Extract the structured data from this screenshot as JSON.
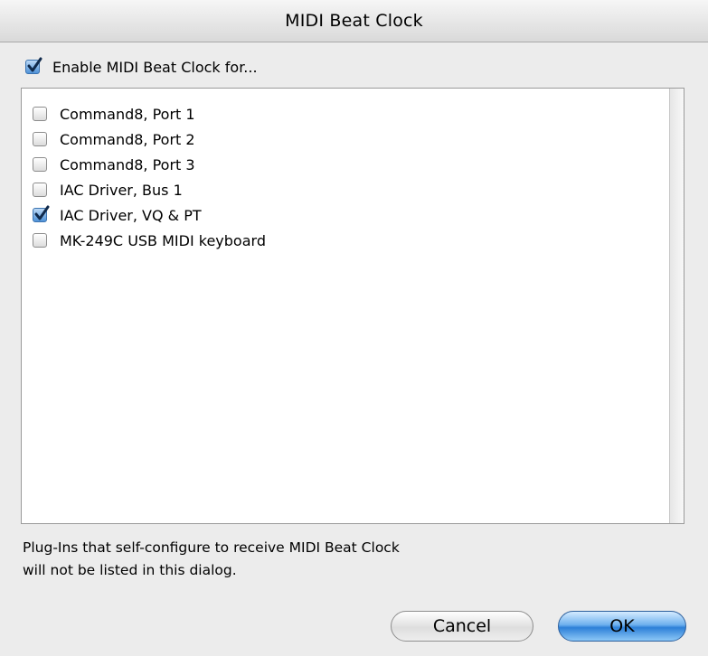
{
  "window": {
    "title": "MIDI Beat Clock"
  },
  "master": {
    "label": "Enable MIDI Beat Clock for...",
    "checked": true
  },
  "ports": [
    {
      "label": "Command8, Port 1",
      "checked": false
    },
    {
      "label": "Command8, Port 2",
      "checked": false
    },
    {
      "label": "Command8, Port 3",
      "checked": false
    },
    {
      "label": "IAC Driver, Bus 1",
      "checked": false
    },
    {
      "label": "IAC Driver, VQ & PT",
      "checked": true
    },
    {
      "label": "MK-249C USB MIDI keyboard",
      "checked": false
    }
  ],
  "info": {
    "line1": "Plug-Ins that self-configure to receive MIDI Beat Clock",
    "line2": "will not be listed in this dialog."
  },
  "buttons": {
    "cancel": "Cancel",
    "ok": "OK"
  },
  "colors": {
    "accent": "#3b82d6",
    "background": "#ececec"
  }
}
